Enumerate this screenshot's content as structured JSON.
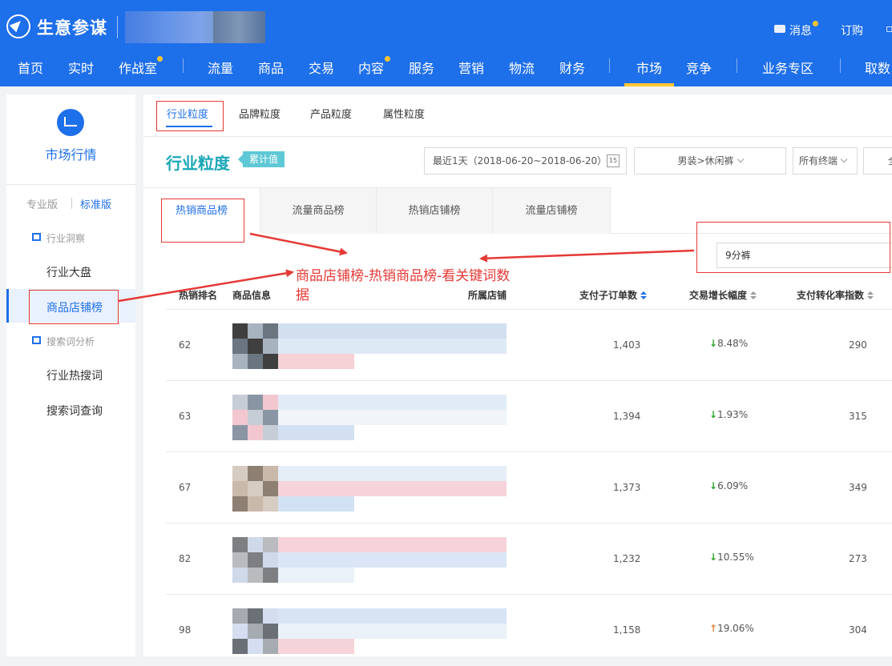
{
  "app": {
    "brand": "生意参谋",
    "util_links": [
      "消息",
      "订购"
    ],
    "nav": [
      "首页",
      "实时",
      "作战室",
      "流量",
      "商品",
      "交易",
      "内容",
      "服务",
      "营销",
      "物流",
      "财务",
      "市场",
      "竞争",
      "业务专区",
      "取数"
    ],
    "active_nav": "市场"
  },
  "sidebar": {
    "title": "市场行情",
    "versions": [
      "专业版",
      "标准版"
    ],
    "groups": [
      {
        "label": "行业洞察",
        "items": [
          "行业大盘",
          "商品店铺榜"
        ]
      },
      {
        "label": "搜索词分析",
        "items": [
          "行业热搜词",
          "搜索词查询"
        ]
      }
    ],
    "active_item": "商品店铺榜"
  },
  "main": {
    "top_tabs": [
      "行业粒度",
      "品牌粒度",
      "产品粒度",
      "属性粒度"
    ],
    "page_title": "行业粒度",
    "badge": "累计值",
    "date_range": "最近1天（2018-06-20~2018-06-20）",
    "calendar_day": "15",
    "category": "男装>休闲裤",
    "terminal": "所有终端",
    "more_ctrl": "全",
    "sub_tabs": [
      "热销商品榜",
      "流量商品榜",
      "热销店铺榜",
      "流量店铺榜"
    ],
    "search_value": "9分裤",
    "columns": [
      "热销排名",
      "商品信息",
      "所属店铺",
      "支付子订单数",
      "交易增长幅度",
      "支付转化率指数"
    ],
    "rows": [
      {
        "rank": "62",
        "orders": "1,403",
        "growth": "8.48%",
        "dir": "↓",
        "conv": "290"
      },
      {
        "rank": "63",
        "orders": "1,394",
        "growth": "1.93%",
        "dir": "↓",
        "conv": "315"
      },
      {
        "rank": "67",
        "orders": "1,373",
        "growth": "6.09%",
        "dir": "↓",
        "conv": "349"
      },
      {
        "rank": "82",
        "orders": "1,232",
        "growth": "10.55%",
        "dir": "↓",
        "conv": "273"
      },
      {
        "rank": "98",
        "orders": "1,158",
        "growth": "19.06%",
        "dir": "↑",
        "conv": "304"
      }
    ]
  },
  "annotation": {
    "text": "商品店铺榜-热销商品榜-看关键词数据",
    "color": "#e53935"
  },
  "colors": {
    "primary": "#1e6fea",
    "accent_yellow": "#ffc530",
    "teal": "#1ba7b8",
    "down_green": "#2aa52a",
    "up_orange": "#e8833a"
  }
}
